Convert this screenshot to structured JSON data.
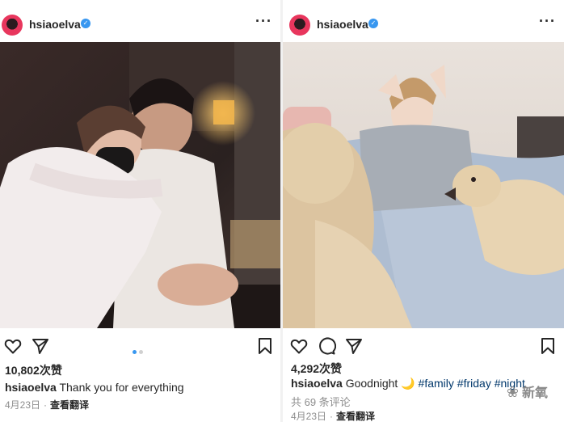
{
  "left_post": {
    "username": "hsiaoelva",
    "likes": "10,802次赞",
    "caption_user": "hsiaoelva",
    "caption_text": "Thank you for everything",
    "date": "4月23日",
    "translate": "查看翻译"
  },
  "right_post": {
    "username": "hsiaoelva",
    "likes": "4,292次赞",
    "caption_user": "hsiaoelva",
    "caption_text": "Goodnight 🌙",
    "tags": [
      "#family",
      "#friday",
      "#night"
    ],
    "comments": "共 69 条评论",
    "date": "4月23日",
    "translate": "查看翻译"
  },
  "watermark": "新氧",
  "colors": {
    "verified": "#3897f0",
    "carousel_active": "#3897f0",
    "carousel_inactive": "#d0d0d0",
    "hashtag": "#00376b",
    "meta": "#8e8e8e"
  },
  "icons": [
    "more-icon",
    "heart-icon",
    "comment-icon",
    "share-icon",
    "save-icon",
    "verified-icon"
  ]
}
